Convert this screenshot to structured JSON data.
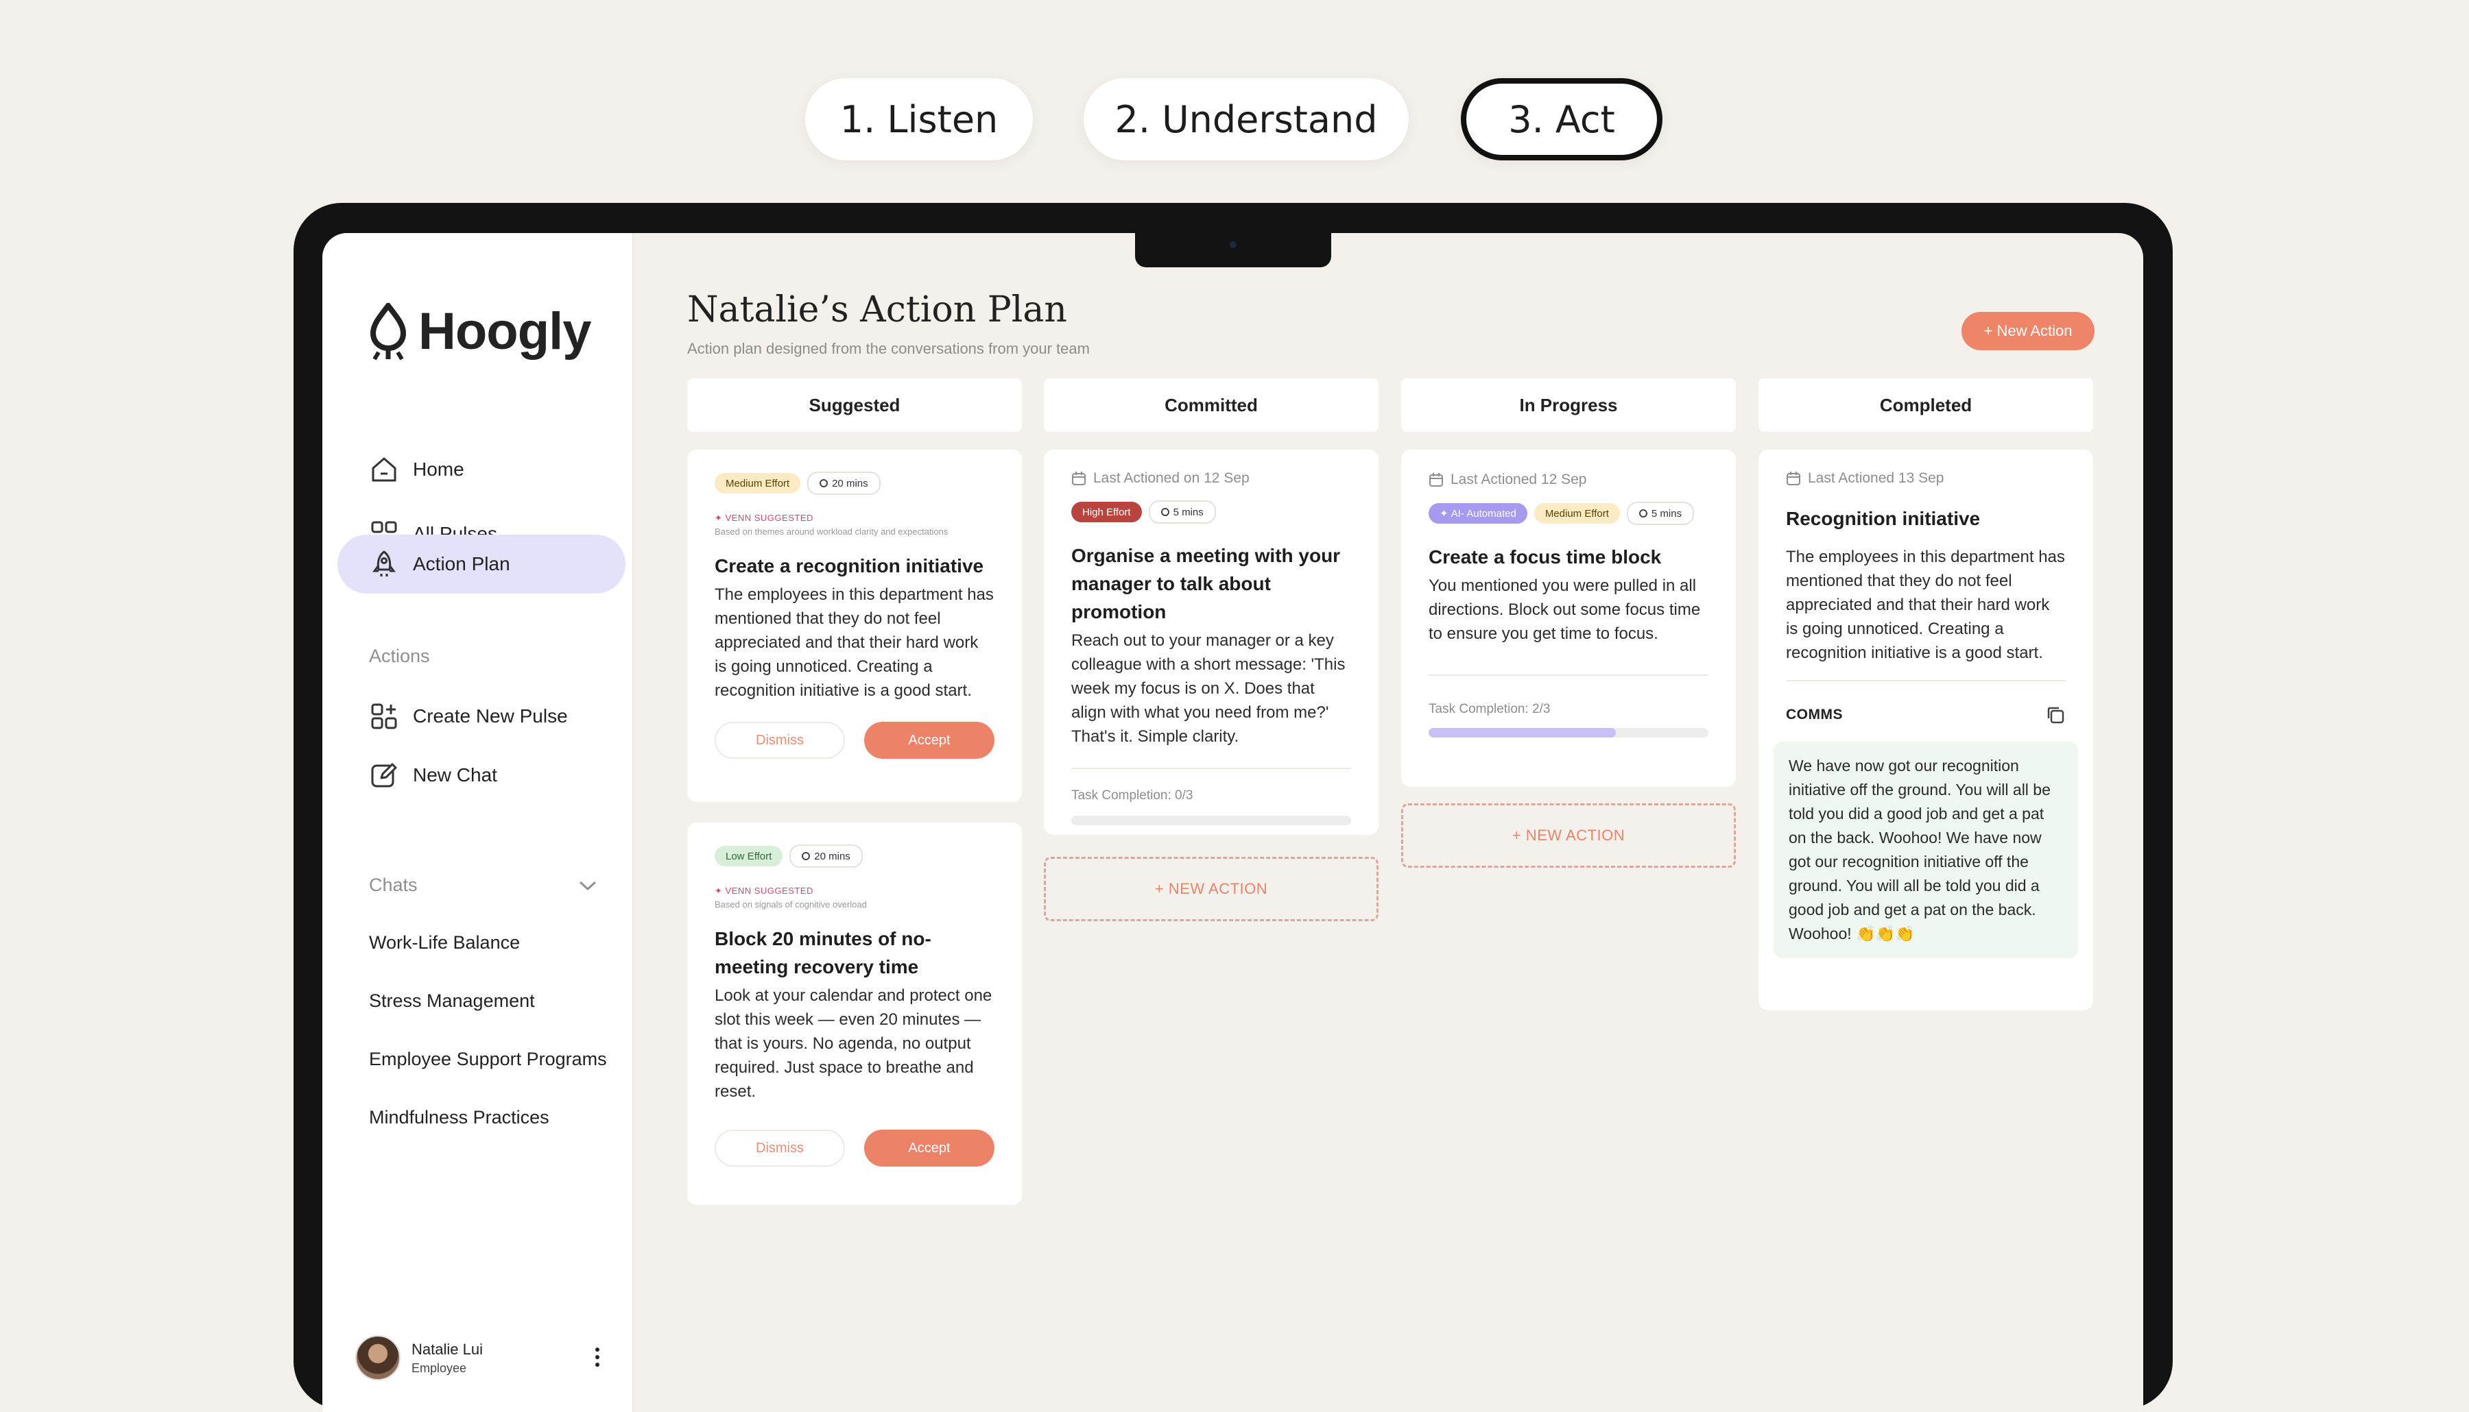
{
  "steps": [
    {
      "label": "1. Listen",
      "active": false
    },
    {
      "label": "2. Understand",
      "active": false
    },
    {
      "label": "3. Act",
      "active": true
    }
  ],
  "app": {
    "brand": "Hoogly",
    "nav": [
      {
        "label": "Home",
        "icon": "home-icon"
      },
      {
        "label": "All Pulses",
        "icon": "grid-icon"
      },
      {
        "label": "Action Plan",
        "icon": "rocket-icon",
        "active": true
      }
    ],
    "actions_label": "Actions",
    "actions": [
      {
        "label": "Create New Pulse",
        "icon": "grid-plus-icon"
      },
      {
        "label": "New Chat",
        "icon": "edit-icon"
      }
    ],
    "chats_label": "Chats",
    "chats": [
      "Work-Life Balance",
      "Stress Management",
      "Employee Support Programs",
      "Mindfulness Practices"
    ],
    "user": {
      "name": "Natalie Lui",
      "role": "Employee"
    }
  },
  "page": {
    "title": "Natalie’s Action Plan",
    "subtitle": "Action plan designed from the conversations from your team",
    "new_action": "+ New Action"
  },
  "columns": [
    "Suggested",
    "Committed",
    "In Progress",
    "Completed"
  ],
  "suggested": [
    {
      "effort": "Medium Effort",
      "time": "20 mins",
      "venn": "VENN SUGGESTED",
      "basis": "Based on themes around workload clarity and expectations",
      "title": "Create a recognition initiative",
      "body": "The employees in this department has mentioned that they do not feel appreciated and that their hard work is going unnoticed. Creating a recognition initiative is a good start.",
      "dismiss": "Dismiss",
      "accept": "Accept"
    },
    {
      "effort": "Low Effort",
      "time": "20 mins",
      "venn": "VENN SUGGESTED",
      "basis": "Based on signals of cognitive overload",
      "title": "Block 20 minutes of no-meeting recovery time",
      "body": "Look at your calendar and protect one slot this week — even 20 minutes — that is yours. No agenda, no output required. Just space to breathe and reset.",
      "dismiss": "Dismiss",
      "accept": "Accept"
    }
  ],
  "committed": {
    "last_actioned": "Last Actioned on 12 Sep",
    "effort": "High Effort",
    "time": "5 mins",
    "title": "Organise a meeting with your manager to talk about promotion",
    "body": "Reach out to your manager or a key colleague with a short message: 'This week my focus is on X. Does that align with what you need from me?' That's it. Simple clarity.",
    "progress_label": "Task Completion: 0/3",
    "progress": 0,
    "add": "+ NEW ACTION"
  },
  "in_progress": {
    "last_actioned": "Last Actioned 12 Sep",
    "ai": "AI- Automated",
    "effort": "Medium Effort",
    "time": "5 mins",
    "title": "Create a focus time block",
    "body": "You mentioned you were pulled in all directions. Block out some focus time to ensure you get time to focus.",
    "progress_label": "Task Completion: 2/3",
    "progress": 0.67,
    "add": "+ NEW ACTION"
  },
  "completed": {
    "last_actioned": "Last Actioned 13 Sep",
    "title": "Recognition initiative",
    "body": "The employees in this department has mentioned that they do not feel appreciated and that their hard work is going unnoticed. Creating a recognition initiative is a good start.",
    "comms_label": "COMMS",
    "comms": "We have now got our recognition initiative off the ground. You will all be told you did a good job and get a pat on the back. Woohoo! We have now got our recognition initiative off the ground. You will all be told you did a good job and get a pat on the back. Woohoo! 👏👏👏"
  }
}
